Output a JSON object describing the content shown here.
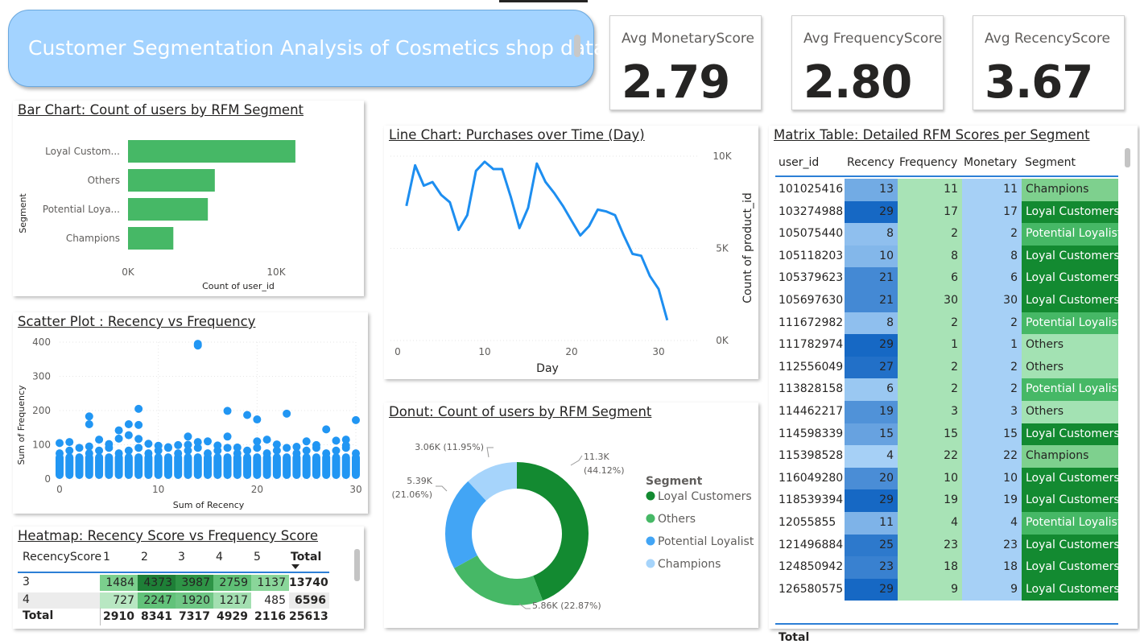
{
  "title": "Customer Segmentation Analysis of Cosmetics shop data",
  "kpis": [
    {
      "label": "Avg MonetaryScore",
      "value": "2.79"
    },
    {
      "label": "Avg FrequencyScore",
      "value": "2.80"
    },
    {
      "label": "Avg RecencyScore",
      "value": "3.67"
    }
  ],
  "colors": {
    "bar_green": "#46b866",
    "line_blue": "#1d8ef0",
    "scatter_blue": "#2196f3",
    "loyal": "#138a31",
    "others": "#46b866",
    "potential": "#42a5f5",
    "champions": "#a6d4fb"
  },
  "bar_chart": {
    "title": "Bar Chart: Count of users by RFM Segment",
    "ylabel": "Segment",
    "xlabel": "Count of user_id",
    "x_ticks": [
      "0K",
      "10K"
    ],
    "chart_data": {
      "type": "bar",
      "orientation": "horizontal",
      "categories": [
        "Loyal Custom...",
        "Others",
        "Potential Loya...",
        "Champions"
      ],
      "values": [
        11300,
        5860,
        5390,
        3060
      ],
      "xlim": [
        0,
        12000
      ]
    }
  },
  "line_chart": {
    "title": "Line Chart: Purchases over Time (Day)",
    "xlabel": "Day",
    "ylabel": "Count of product_id",
    "x_ticks": [
      "0",
      "10",
      "20",
      "30"
    ],
    "y_ticks": [
      "10K",
      "5K",
      "0K"
    ],
    "chart_data": {
      "type": "line",
      "x": [
        1,
        2,
        3,
        4,
        5,
        6,
        7,
        8,
        9,
        10,
        11,
        12,
        13,
        14,
        15,
        16,
        17,
        18,
        19,
        20,
        21,
        22,
        23,
        24,
        25,
        26,
        27,
        28,
        29,
        30,
        31
      ],
      "y": [
        7300,
        9500,
        8400,
        8600,
        7900,
        7500,
        6000,
        6800,
        9200,
        9700,
        9300,
        9300,
        7800,
        6100,
        7200,
        9600,
        8600,
        8000,
        7300,
        6500,
        5700,
        6200,
        7100,
        7000,
        6800,
        5700,
        4700,
        4600,
        3500,
        2800,
        1100
      ],
      "xlim": [
        0,
        33
      ],
      "ylim": [
        0,
        10000
      ]
    }
  },
  "scatter": {
    "title": "Scatter Plot : Recency vs Frequency",
    "xlabel": "Sum of Recency",
    "ylabel": "Sum of Frequency",
    "x_ticks": [
      "0",
      "10",
      "20",
      "30"
    ],
    "y_ticks": [
      "400",
      "300",
      "200",
      "100",
      "0"
    ],
    "chart_data": {
      "type": "scatter",
      "xlim": [
        0,
        30
      ],
      "ylim": [
        0,
        400
      ],
      "outliers": [
        {
          "x": 0,
          "y": 105
        },
        {
          "x": 1,
          "y": 108
        },
        {
          "x": 3,
          "y": 95
        },
        {
          "x": 3,
          "y": 160
        },
        {
          "x": 3,
          "y": 183
        },
        {
          "x": 4,
          "y": 115
        },
        {
          "x": 5,
          "y": 102
        },
        {
          "x": 6,
          "y": 118
        },
        {
          "x": 6,
          "y": 142
        },
        {
          "x": 7,
          "y": 160
        },
        {
          "x": 7,
          "y": 128
        },
        {
          "x": 8,
          "y": 205
        },
        {
          "x": 8,
          "y": 158
        },
        {
          "x": 8,
          "y": 117
        },
        {
          "x": 9,
          "y": 103
        },
        {
          "x": 10,
          "y": 97
        },
        {
          "x": 11,
          "y": 93
        },
        {
          "x": 12,
          "y": 99
        },
        {
          "x": 13,
          "y": 100
        },
        {
          "x": 13,
          "y": 124
        },
        {
          "x": 14,
          "y": 390
        },
        {
          "x": 14,
          "y": 395
        },
        {
          "x": 14,
          "y": 108
        },
        {
          "x": 15,
          "y": 110
        },
        {
          "x": 16,
          "y": 98
        },
        {
          "x": 17,
          "y": 199
        },
        {
          "x": 17,
          "y": 124
        },
        {
          "x": 18,
          "y": 92
        },
        {
          "x": 19,
          "y": 187
        },
        {
          "x": 20,
          "y": 174
        },
        {
          "x": 20,
          "y": 110
        },
        {
          "x": 21,
          "y": 115
        },
        {
          "x": 22,
          "y": 101
        },
        {
          "x": 23,
          "y": 191
        },
        {
          "x": 24,
          "y": 94
        },
        {
          "x": 25,
          "y": 110
        },
        {
          "x": 26,
          "y": 99
        },
        {
          "x": 27,
          "y": 145
        },
        {
          "x": 28,
          "y": 112
        },
        {
          "x": 29,
          "y": 98
        },
        {
          "x": 29,
          "y": 115
        },
        {
          "x": 30,
          "y": 172
        }
      ],
      "dense_band_max": 75
    }
  },
  "heatmap": {
    "title": "Heatmap: Recency Score vs Frequency Score",
    "row_header": "RecencyScore",
    "columns": [
      "1",
      "2",
      "3",
      "4",
      "5"
    ],
    "total_label": "Total",
    "rows": [
      {
        "label": "3",
        "values": [
          "1484",
          "4373",
          "3987",
          "2759",
          "1137"
        ],
        "total": "13740"
      },
      {
        "label": "4",
        "values": [
          "727",
          "2247",
          "1920",
          "1217",
          "485"
        ],
        "total": "6596"
      }
    ],
    "totals": {
      "label": "Total",
      "values": [
        "2910",
        "8341",
        "7317",
        "4929",
        "2116"
      ],
      "total": "25613"
    },
    "cell_colors": [
      [
        "#7bcf8d",
        "#1e7f37",
        "#2e9446",
        "#5fbf76",
        "#8ad69a"
      ],
      [
        "#b8e7c2",
        "#62c27a",
        "#6fc785",
        "#a3dfb1",
        "#ffffff"
      ]
    ]
  },
  "donut": {
    "title": "Donut: Count of users by RFM Segment",
    "legend_title": "Segment",
    "chart_data": {
      "type": "pie",
      "categories": [
        "Loyal Customers",
        "Others",
        "Potential Loyalist",
        "Champions"
      ],
      "values": [
        11300,
        5860,
        5390,
        3060
      ],
      "labels": [
        "11.3K\n(44.12%)",
        "5.86K (22.87%)",
        "5.39K\n(21.06%)",
        "3.06K (11.95%)"
      ],
      "colors": [
        "#138a31",
        "#46b866",
        "#42a5f5",
        "#a6d4fb"
      ]
    }
  },
  "matrix": {
    "title": "Matrix Table: Detailed RFM Scores per Segment",
    "headers": [
      "user_id",
      "Recency",
      "Frequency",
      "Monetary",
      "Segment"
    ],
    "total_label": "Total",
    "rows": [
      {
        "user_id": "101025416",
        "recency": "13",
        "frequency": "11",
        "monetary": "11",
        "segment": "Champions"
      },
      {
        "user_id": "103274988",
        "recency": "29",
        "frequency": "17",
        "monetary": "17",
        "segment": "Loyal Customers"
      },
      {
        "user_id": "105075440",
        "recency": "8",
        "frequency": "2",
        "monetary": "2",
        "segment": "Potential Loyalist"
      },
      {
        "user_id": "105118203",
        "recency": "10",
        "frequency": "8",
        "monetary": "8",
        "segment": "Loyal Customers"
      },
      {
        "user_id": "105379623",
        "recency": "21",
        "frequency": "6",
        "monetary": "6",
        "segment": "Loyal Customers"
      },
      {
        "user_id": "105697630",
        "recency": "21",
        "frequency": "30",
        "monetary": "30",
        "segment": "Loyal Customers"
      },
      {
        "user_id": "111672982",
        "recency": "8",
        "frequency": "2",
        "monetary": "2",
        "segment": "Potential Loyalist"
      },
      {
        "user_id": "111782974",
        "recency": "29",
        "frequency": "1",
        "monetary": "1",
        "segment": "Others"
      },
      {
        "user_id": "112556049",
        "recency": "27",
        "frequency": "2",
        "monetary": "2",
        "segment": "Others"
      },
      {
        "user_id": "113828158",
        "recency": "6",
        "frequency": "2",
        "monetary": "2",
        "segment": "Potential Loyalist"
      },
      {
        "user_id": "114462217",
        "recency": "19",
        "frequency": "3",
        "monetary": "3",
        "segment": "Others"
      },
      {
        "user_id": "114598339",
        "recency": "15",
        "frequency": "15",
        "monetary": "15",
        "segment": "Loyal Customers"
      },
      {
        "user_id": "115398528",
        "recency": "4",
        "frequency": "22",
        "monetary": "22",
        "segment": "Champions"
      },
      {
        "user_id": "116049280",
        "recency": "20",
        "frequency": "10",
        "monetary": "10",
        "segment": "Loyal Customers"
      },
      {
        "user_id": "118539394",
        "recency": "29",
        "frequency": "19",
        "monetary": "19",
        "segment": "Loyal Customers"
      },
      {
        "user_id": "12055855",
        "recency": "11",
        "frequency": "4",
        "monetary": "4",
        "segment": "Potential Loyalist"
      },
      {
        "user_id": "121496884",
        "recency": "25",
        "frequency": "23",
        "monetary": "23",
        "segment": "Loyal Customers"
      },
      {
        "user_id": "124850942",
        "recency": "23",
        "frequency": "18",
        "monetary": "18",
        "segment": "Loyal Customers"
      },
      {
        "user_id": "126580575",
        "recency": "29",
        "frequency": "9",
        "monetary": "9",
        "segment": "Loyal Customers"
      }
    ]
  }
}
